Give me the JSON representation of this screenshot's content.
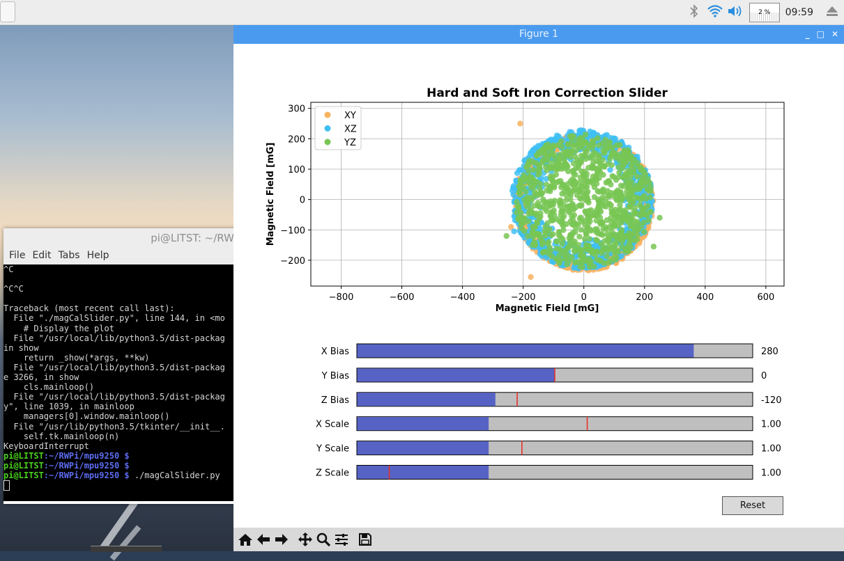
{
  "panel": {
    "cpu_label": "2 %",
    "clock": "09:59"
  },
  "terminal": {
    "title": "pi@LITST: ~/RWP",
    "menu": [
      "File",
      "Edit",
      "Tabs",
      "Help"
    ],
    "lines": [
      "^C",
      "",
      "^C^C",
      "",
      "Traceback (most recent call last):",
      "  File \"./magCalSlider.py\", line 144, in <mo",
      "    # Display the plot",
      "  File \"/usr/local/lib/python3.5/dist-packag",
      "in show",
      "    return _show(*args, **kw)",
      "  File \"/usr/local/lib/python3.5/dist-packag",
      "e 3266, in show",
      "    cls.mainloop()",
      "  File \"/usr/local/lib/python3.5/dist-packag",
      "y\", line 1039, in mainloop",
      "    managers[0].window.mainloop()",
      "  File \"/usr/lib/python3.5/tkinter/__init__.",
      "    self.tk.mainloop(n)",
      "KeyboardInterrupt"
    ],
    "prompts": [
      {
        "user": "pi@LITST",
        "path": ":~/RWPi/mpu9250 $",
        "cmd": ""
      },
      {
        "user": "pi@LITST",
        "path": ":~/RWPi/mpu9250 $",
        "cmd": ""
      },
      {
        "user": "pi@LITST",
        "path": ":~/RWPi/mpu9250 $",
        "cmd": " ./magCalSlider.py"
      }
    ]
  },
  "figure": {
    "window_title": "Figure 1",
    "reset_label": "Reset"
  },
  "chart_data": {
    "type": "scatter",
    "title": "Hard and Soft Iron Correction Slider",
    "xlabel": "Magnetic Field [mG]",
    "ylabel": "Magnetic Field [mG]",
    "xlim": [
      -900,
      660
    ],
    "ylim": [
      -285,
      320
    ],
    "xticks": [
      -800,
      -600,
      -400,
      -200,
      0,
      200,
      400,
      600
    ],
    "yticks": [
      -200,
      -100,
      0,
      100,
      200,
      300
    ],
    "xtick_labels": [
      "−800",
      "−600",
      "−400",
      "−200",
      "0",
      "200",
      "400",
      "600"
    ],
    "ytick_labels": [
      "−200",
      "−100",
      "0",
      "100",
      "200",
      "300"
    ],
    "grid": true,
    "legend_position": "top-left",
    "series": [
      {
        "name": "XY",
        "color": "#f9b25f",
        "center": [
          0,
          -10
        ],
        "radius": 225,
        "outliers": [
          [
            -210,
            250
          ],
          [
            -175,
            -255
          ],
          [
            -240,
            -90
          ]
        ]
      },
      {
        "name": "XZ",
        "color": "#3fc0f5",
        "center": [
          -5,
          0
        ],
        "radius": 240,
        "outliers": [
          [
            -230,
            -105
          ]
        ]
      },
      {
        "name": "YZ",
        "color": "#78c554",
        "center": [
          0,
          -5
        ],
        "radius": 225,
        "outliers": [
          [
            -255,
            -120
          ],
          [
            250,
            -60
          ],
          [
            230,
            -155
          ]
        ]
      }
    ]
  },
  "sliders": [
    {
      "label": "X Bias",
      "value_text": "280",
      "fill": 0.851,
      "init": null
    },
    {
      "label": "Y Bias",
      "value_text": "0",
      "fill": 0.5,
      "init": 0.5
    },
    {
      "label": "Z Bias",
      "value_text": "-120",
      "fill": 0.35,
      "init": 0.405
    },
    {
      "label": "X Scale",
      "value_text": "1.00",
      "fill": 0.333,
      "init": 0.582
    },
    {
      "label": "Y Scale",
      "value_text": "1.00",
      "fill": 0.333,
      "init": 0.417
    },
    {
      "label": "Z Scale",
      "value_text": "1.00",
      "fill": 0.333,
      "init": 0.082
    }
  ],
  "colors": {
    "slider_fill": "#5663c5",
    "slider_track": "#bfbfbf",
    "slider_init": "#e8312a",
    "titlebar": "#4a9bef"
  },
  "toolbar": [
    "home-icon",
    "back-icon",
    "forward-icon",
    "pan-icon",
    "zoom-icon",
    "configure-icon",
    "save-icon"
  ]
}
